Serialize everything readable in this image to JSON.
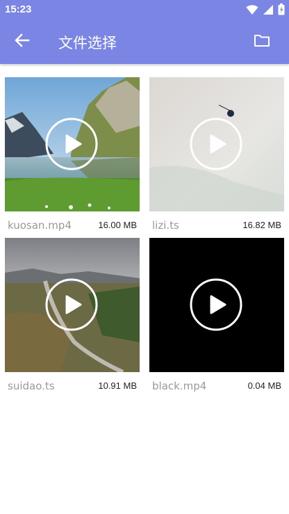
{
  "status_bar": {
    "time": "15:23",
    "icons": [
      "wifi-icon",
      "signal-icon",
      "battery-icon"
    ]
  },
  "app_bar": {
    "title": "文件选择",
    "back_icon": "arrow-left-icon",
    "folder_icon": "folder-icon"
  },
  "colors": {
    "primary": "#7b86e4",
    "filename_text": "#999999",
    "size_text": "#222222"
  },
  "files": [
    {
      "name": "kuosan.mp4",
      "size": "16.00 MB"
    },
    {
      "name": "lizi.ts",
      "size": "16.82 MB"
    },
    {
      "name": "suidao.ts",
      "size": "10.91 MB"
    },
    {
      "name": "black.mp4",
      "size": "0.04 MB"
    }
  ]
}
